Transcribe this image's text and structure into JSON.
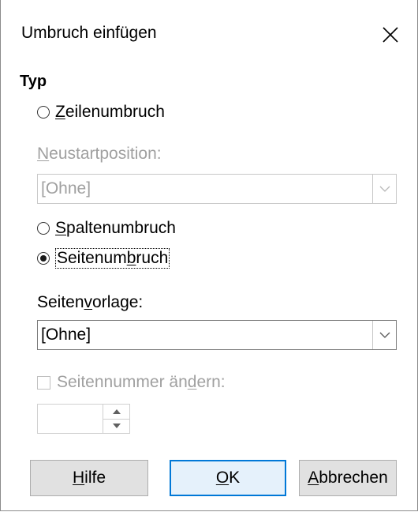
{
  "window": {
    "title": "Umbruch einfügen",
    "close_icon": "close-icon"
  },
  "typ_section": {
    "title": "Typ"
  },
  "options": {
    "line_break": {
      "pre": "",
      "accel": "Z",
      "post": "eilenumbruch",
      "checked": false
    },
    "restart_label": {
      "pre": "",
      "accel": "N",
      "post": "eustartposition:"
    },
    "restart_combo": {
      "value": "[Ohne]",
      "enabled": false
    },
    "column_break": {
      "pre": "",
      "accel": "S",
      "post": "paltenumbruch",
      "checked": false
    },
    "page_break": {
      "pre": "Seitenum",
      "accel": "b",
      "post": "ruch",
      "checked": true
    },
    "page_style_label": {
      "pre": "Seiten",
      "accel": "v",
      "post": "orlage:"
    },
    "page_style_combo": {
      "value": "[Ohne]",
      "enabled": true
    },
    "change_page_number": {
      "pre": "Seitennummer än",
      "accel": "d",
      "post": "ern:",
      "checked": false,
      "enabled": false
    },
    "page_number_spin": {
      "value": ""
    }
  },
  "buttons": {
    "help": {
      "pre": "",
      "accel": "H",
      "post": "ilfe"
    },
    "ok": {
      "pre": "",
      "accel": "O",
      "post": "K"
    },
    "cancel": {
      "pre": "",
      "accel": "A",
      "post": "bbrechen"
    }
  }
}
